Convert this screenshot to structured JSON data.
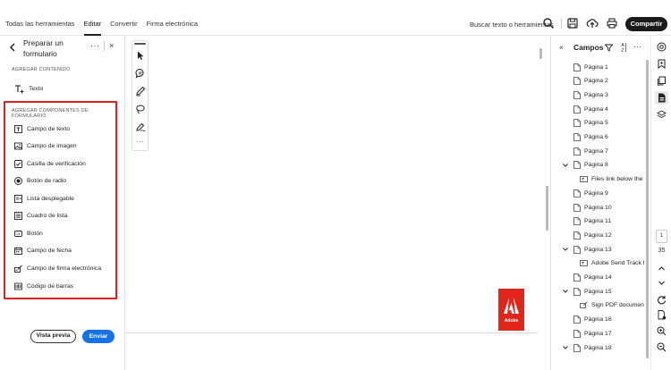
{
  "menu": [
    "Todas las herramientas",
    "Editar",
    "Convertir",
    "Firma electrónica"
  ],
  "search_label": "Buscar texto o herramientas",
  "share_label": "Compartir",
  "left_panel": {
    "title": "Preparar un formulario",
    "more": "···",
    "close": "×",
    "section_content": "AGREGAR CONTENIDO",
    "text_item": "Texto",
    "section_components": "AGREGAR COMPONENTES DE FORMULARIO",
    "components": [
      "Campo de texto",
      "Campo de imagen",
      "Casilla de verificación",
      "Botón de radio",
      "Lista desplegable",
      "Cuadro de lista",
      "Botón",
      "Campo de fecha",
      "Campo de firma electrónica",
      "Código de barras"
    ],
    "preview_label": "Vista previa",
    "send_label": "Enviar"
  },
  "canvas": {
    "tool_more": "···",
    "logo_text": "Adobe"
  },
  "right_panel": {
    "close": "×",
    "title": "Campos",
    "more": "···",
    "rows": [
      {
        "label": "Página 1",
        "level": 0
      },
      {
        "label": "Página 2",
        "level": 0
      },
      {
        "label": "Página 3",
        "level": 0
      },
      {
        "label": "Página 4",
        "level": 0
      },
      {
        "label": "Página 5",
        "level": 0
      },
      {
        "label": "Página 6",
        "level": 0
      },
      {
        "label": "Página 7",
        "level": 0
      },
      {
        "label": "Página 8",
        "level": 0,
        "expanded": true
      },
      {
        "label": "Files link below the Se",
        "level": 1,
        "kind": "field"
      },
      {
        "label": "Página 9",
        "level": 0
      },
      {
        "label": "Página 10",
        "level": 0
      },
      {
        "label": "Página 11",
        "level": 0
      },
      {
        "label": "Página 12",
        "level": 0
      },
      {
        "label": "Página 13",
        "level": 0,
        "expanded": true
      },
      {
        "label": "Adobe Send  Track fo",
        "level": 1,
        "kind": "field"
      },
      {
        "label": "Página 14",
        "level": 0
      },
      {
        "label": "Página 15",
        "level": 0,
        "expanded": true
      },
      {
        "label": "Sign PDF documents",
        "level": 1,
        "kind": "sign"
      },
      {
        "label": "Página 16",
        "level": 0
      },
      {
        "label": "Página 17",
        "level": 0
      },
      {
        "label": "Página 18",
        "level": 0,
        "expanded": true
      }
    ]
  },
  "rail": {
    "current_page": "1",
    "total_pages": "35"
  },
  "colors": {
    "highlight_box": "#e02020",
    "primary_button": "#1473e6",
    "share_button": "#1a1a1a",
    "adobe_logo": "#e1251b"
  }
}
